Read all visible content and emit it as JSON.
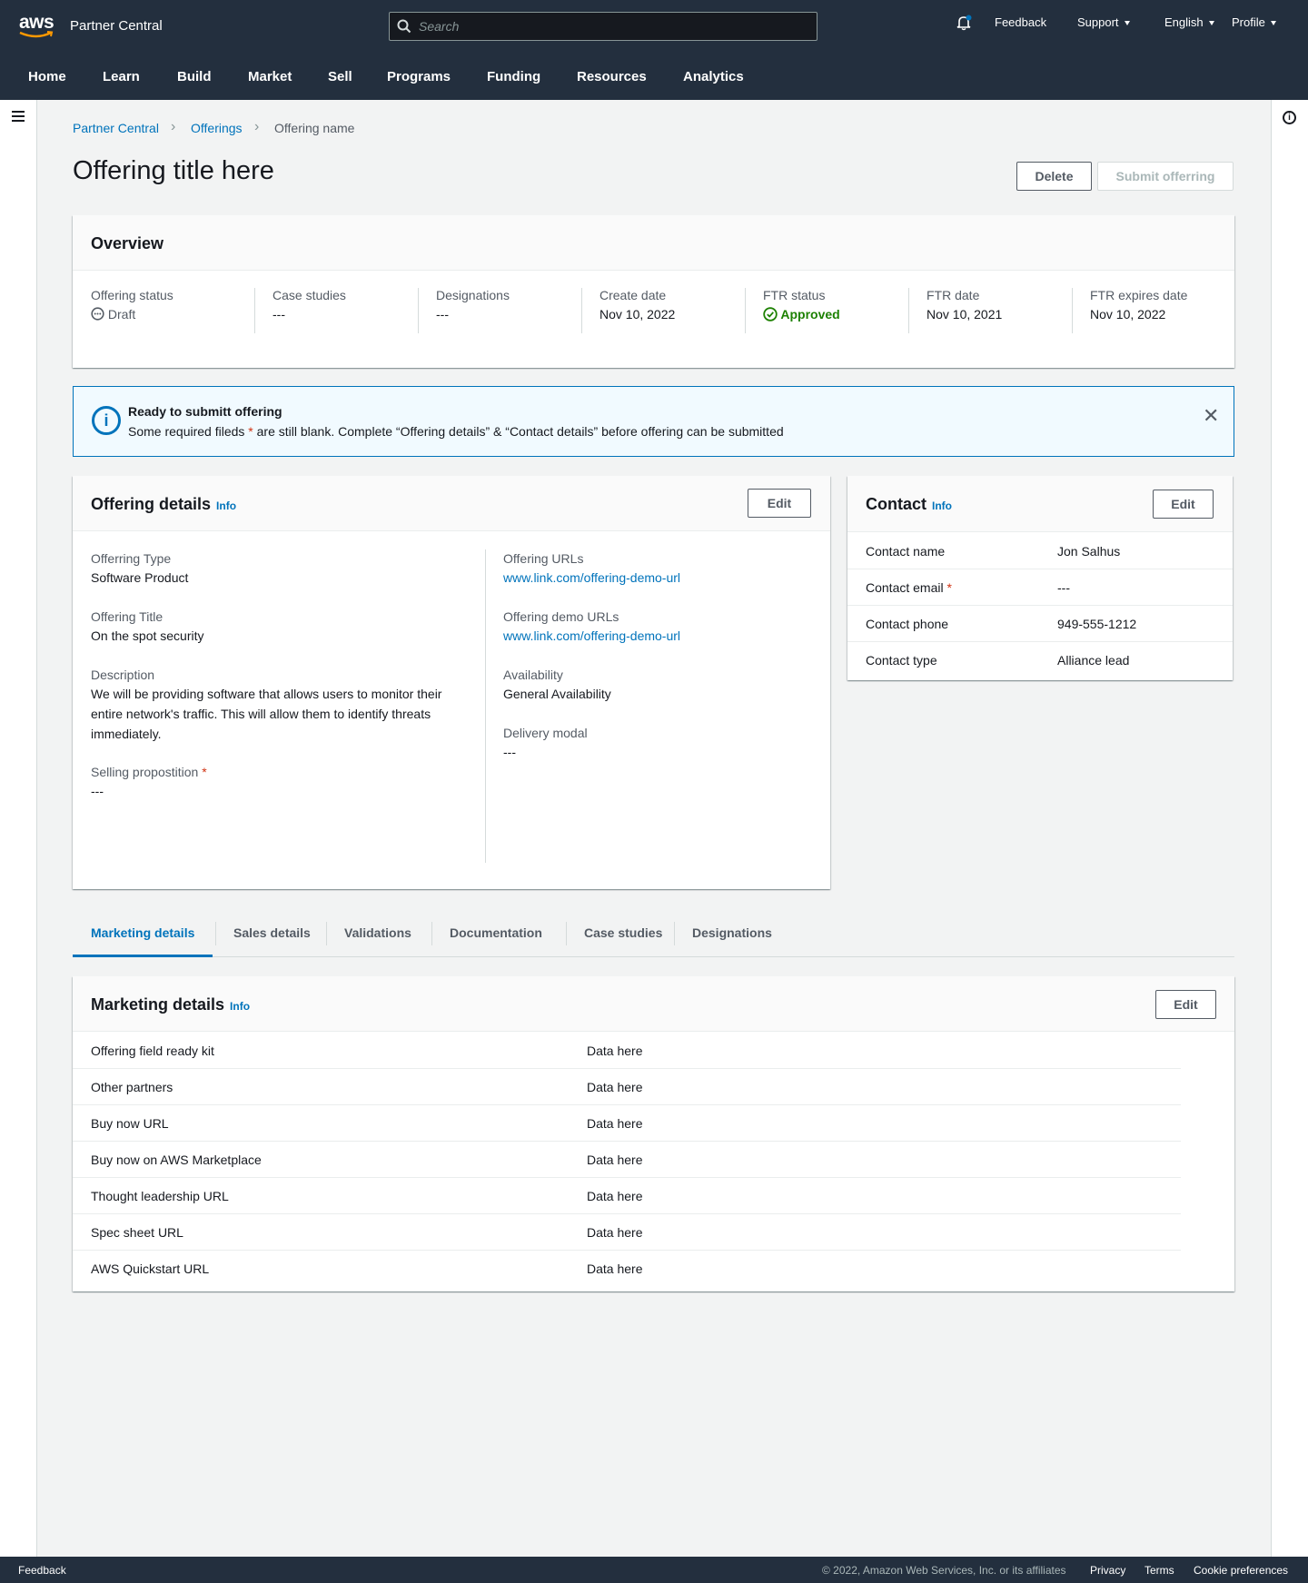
{
  "topbar": {
    "logo_text": "aws",
    "brand": "Partner Central",
    "search_placeholder": "Search",
    "feedback": "Feedback",
    "support": "Support",
    "language": "English",
    "profile": "Profile",
    "nav": [
      "Home",
      "Learn",
      "Build",
      "Market",
      "Sell",
      "Programs",
      "Funding",
      "Resources",
      "Analytics"
    ]
  },
  "breadcrumb": [
    "Partner Central",
    "Offerings",
    "Offering name"
  ],
  "page": {
    "title": "Offering title here",
    "delete_label": "Delete",
    "submit_label": "Submit offerring"
  },
  "overview": {
    "heading": "Overview",
    "columns": [
      {
        "label": "Offering status",
        "value": "Draft"
      },
      {
        "label": "Case studies",
        "value": "---"
      },
      {
        "label": "Designations",
        "value": "---"
      },
      {
        "label": "Create date",
        "value": "Nov 10, 2022"
      },
      {
        "label": "FTR status",
        "value": "Approved"
      },
      {
        "label": "FTR date",
        "value": "Nov 10, 2021"
      },
      {
        "label": "FTR expires date",
        "value": "Nov 10, 2022"
      }
    ]
  },
  "flash": {
    "title": "Ready to submitt offering",
    "msg_before": "Some required fileds ",
    "msg_star": "*",
    "msg_after": " are still blank. Complete “Offering details” & “Contact details” before offering can be submitted"
  },
  "offering_details": {
    "heading": "Offering details",
    "info": "Info",
    "edit": "Edit",
    "left": [
      {
        "label": "Offerring Type",
        "value": "Software Product"
      },
      {
        "label": "Offering Title",
        "value": "On the spot security"
      },
      {
        "label": "Description",
        "value": "We will be providing software that allows users to monitor their entire network's traffic.  This will allow them to identify threats immediately."
      },
      {
        "label": "Selling propostition",
        "value": "---"
      }
    ],
    "right": [
      {
        "label": "Offering URLs",
        "value": "www.link.com/offering-demo-url"
      },
      {
        "label": "Offering demo URLs",
        "value": "www.link.com/offering-demo-url"
      },
      {
        "label": "Availability",
        "value": "General Availability"
      },
      {
        "label": "Delivery modal",
        "value": "---"
      }
    ]
  },
  "contact": {
    "heading": "Contact",
    "info": "Info",
    "edit": "Edit",
    "rows": [
      {
        "key": "Contact name",
        "value": "Jon Salhus"
      },
      {
        "key": "Contact email",
        "value": "---"
      },
      {
        "key": "Contact phone",
        "value": "949-555-1212"
      },
      {
        "key": "Contact type",
        "value": "Alliance lead"
      }
    ]
  },
  "tabs": [
    "Marketing details",
    "Sales details",
    "Validations",
    "Documentation",
    "Case studies",
    "Designations"
  ],
  "marketing": {
    "heading": "Marketing details",
    "info": "Info",
    "edit": "Edit",
    "rows": [
      {
        "key": "Offering field ready kit",
        "value": "Data here"
      },
      {
        "key": "Other partners",
        "value": "Data here"
      },
      {
        "key": "Buy now URL",
        "value": "Data here"
      },
      {
        "key": "Buy now on AWS Marketplace",
        "value": "Data here"
      },
      {
        "key": "Thought leadership URL",
        "value": "Data here"
      },
      {
        "key": "Spec sheet URL",
        "value": "Data here"
      },
      {
        "key": "AWS Quickstart URL",
        "value": "Data here"
      }
    ]
  },
  "footer": {
    "feedback": "Feedback",
    "copyright": "© 2022, Amazon Web Services, Inc. or its affiliates",
    "privacy": "Privacy",
    "terms": "Terms",
    "cookies": "Cookie preferences"
  },
  "colors": {
    "topbar": "#232f3e",
    "link": "#0073bb",
    "success": "#1d8102",
    "required": "#d13212"
  }
}
